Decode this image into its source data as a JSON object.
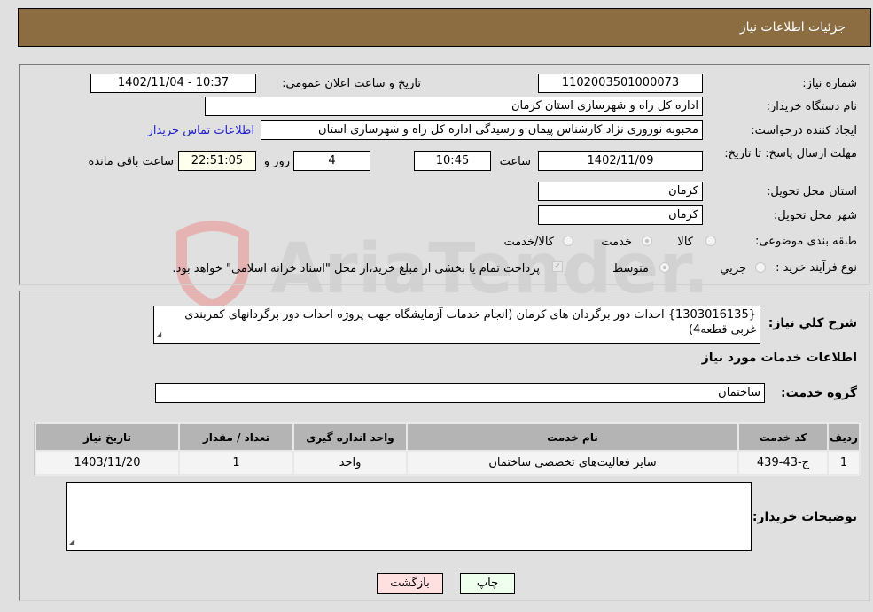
{
  "header": {
    "title": "جزئیات اطلاعات نیاز"
  },
  "form": {
    "need_number_label": "شماره نیاز:",
    "need_number": "1102003501000073",
    "announce_label": "تاریخ و ساعت اعلان عمومی:",
    "announce_value": "1402/11/04 - 10:37",
    "buyer_org_label": "نام دستگاه خریدار:",
    "buyer_org": "اداره کل راه و شهرسازی استان کرمان",
    "creator_label": "ایجاد کننده درخواست:",
    "creator": "محبوبه نوروزی نژاد کارشناس پیمان و رسیدگی اداره کل راه و شهرسازی استان",
    "contact_link": "اطلاعات تماس خریدار",
    "deadline_label": "مهلت ارسال پاسخ: تا تاریخ:",
    "deadline_date": "1402/11/09",
    "time_label": "ساعت",
    "deadline_time": "10:45",
    "days_value": "4",
    "days_label": "روز و",
    "remaining_time": "22:51:05",
    "remaining_label": "ساعت باقي مانده",
    "province_label": "استان محل تحویل:",
    "province": "کرمان",
    "city_label": "شهر محل تحویل:",
    "city": "کرمان",
    "category_label": "طبقه بندی موضوعی:",
    "category_options": [
      {
        "label": "کالا",
        "checked": false
      },
      {
        "label": "خدمت",
        "checked": true
      },
      {
        "label": "کالا/خدمت",
        "checked": false
      }
    ],
    "process_label": "نوع فرآیند خرید :",
    "process_options": [
      {
        "label": "جزيي",
        "checked": false
      },
      {
        "label": "متوسط",
        "checked": true
      }
    ],
    "treasury_note": "پرداخت تمام یا بخشی از مبلغ خرید،از محل \"اسناد خزانه اسلامی\" خواهد بود.",
    "treasury_checked": true
  },
  "details": {
    "description_label": "شرح کلي نیاز:",
    "description": "{1303016135} احداث دور برگردان های کرمان (انجام خدمات آزمایشگاه جهت پروژه احداث دور برگردانهای کمربندی غربی قطعه4)",
    "services_heading": "اطلاعات خدمات مورد نیاز",
    "service_group_label": "گروه خدمت:",
    "service_group": "ساختمان",
    "table": {
      "headers": [
        "ردیف",
        "کد خدمت",
        "نام خدمت",
        "واحد اندازه گیری",
        "تعداد / مقدار",
        "تاریخ نیاز"
      ],
      "rows": [
        [
          "1",
          "ج-43-439",
          "سایر فعالیت‌های تخصصی ساختمان",
          "واحد",
          "1",
          "1403/11/20"
        ]
      ]
    },
    "buyer_notes_label": "توضیحات خریدار:",
    "buyer_notes": ""
  },
  "buttons": {
    "print": "چاپ",
    "back": "بازگشت"
  },
  "watermark": {
    "text": "AriaTender.neT"
  }
}
